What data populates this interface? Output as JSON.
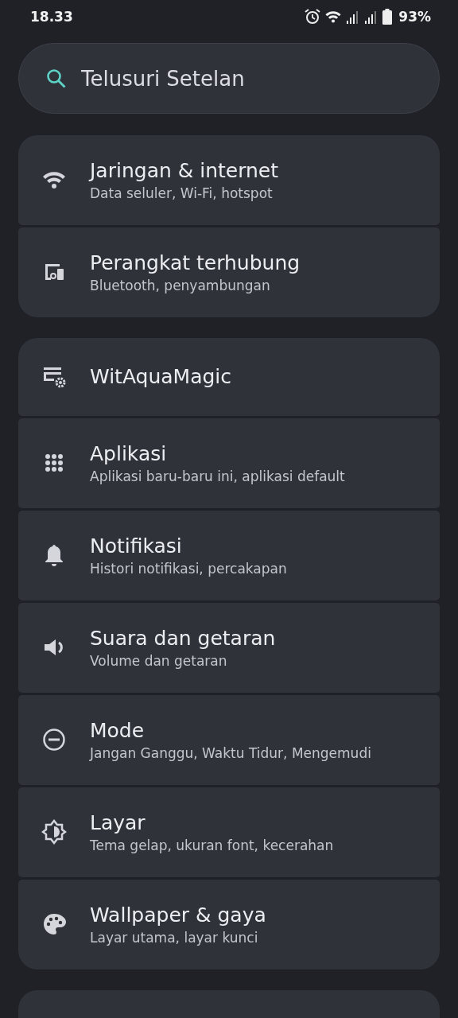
{
  "status_bar": {
    "time": "18.33",
    "battery": "93%"
  },
  "search": {
    "placeholder": "Telusuri Setelan"
  },
  "groups": [
    {
      "items": [
        {
          "title": "Jaringan & internet",
          "subtitle": "Data seluler, Wi-Fi, hotspot"
        },
        {
          "title": "Perangkat terhubung",
          "subtitle": "Bluetooth, penyambungan"
        }
      ]
    },
    {
      "items": [
        {
          "title": "WitAquaMagic"
        },
        {
          "title": "Aplikasi",
          "subtitle": "Aplikasi baru-baru ini, aplikasi default"
        },
        {
          "title": "Notifikasi",
          "subtitle": "Histori notifikasi, percakapan"
        },
        {
          "title": "Suara dan getaran",
          "subtitle": "Volume dan getaran"
        },
        {
          "title": "Mode",
          "subtitle": "Jangan Ganggu, Waktu Tidur, Mengemudi"
        },
        {
          "title": "Layar",
          "subtitle": "Tema gelap, ukuran font, kecerahan"
        },
        {
          "title": "Wallpaper & gaya",
          "subtitle": "Layar utama, layar kunci"
        }
      ]
    }
  ]
}
